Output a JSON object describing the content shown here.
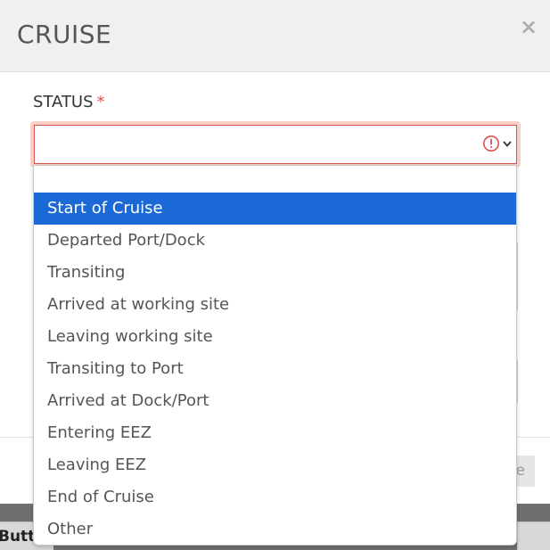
{
  "modal": {
    "title": "CRUISE",
    "close_label": "×"
  },
  "form": {
    "status_label": "STATUS",
    "required_mark": "*",
    "status_value": ""
  },
  "dropdown": {
    "search_value": "",
    "selected_index": 0,
    "options": [
      "Start of Cruise",
      "Departed Port/Dock",
      "Transiting",
      "Arrived at working site",
      "Leaving working site",
      "Transiting to Port",
      "Arrived at Dock/Port",
      "Entering EEZ",
      "Leaving EEZ",
      "End of Cruise",
      "Other"
    ]
  },
  "footer": {
    "button_partial_label": "e"
  },
  "backdrop": {
    "button_partial_label": "Butt"
  },
  "colors": {
    "selected_option": "#1a69d6",
    "error": "#d9534f",
    "required": "#e05050"
  },
  "icons": {
    "error": "exclamation-circle-icon",
    "chevron": "chevron-down-icon",
    "close": "close-icon"
  }
}
